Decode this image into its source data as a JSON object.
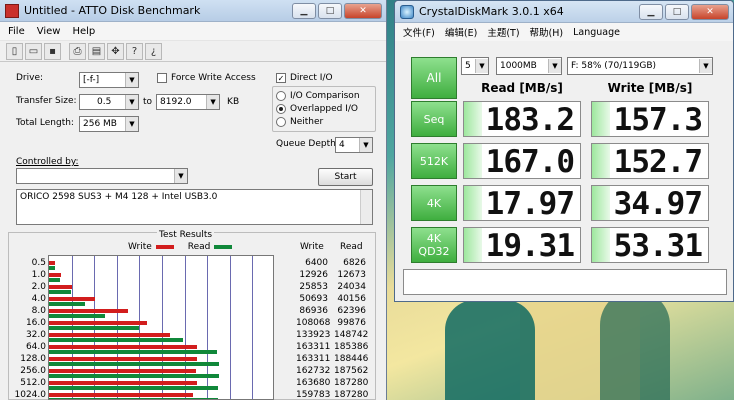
{
  "atto": {
    "title": "Untitled - ATTO Disk Benchmark",
    "menu": [
      "File",
      "View",
      "Help"
    ],
    "toolbar_icons": [
      "new-icon",
      "open-icon",
      "save-icon",
      "print-icon",
      "print-preview-icon",
      "move-icon",
      "help-icon",
      "context-help-icon"
    ],
    "drive_label": "Drive:",
    "drive_value": "[-f-]",
    "transfer_size_label": "Transfer Size:",
    "transfer_from": "0.5",
    "transfer_to_label": "to",
    "transfer_to": "8192.0",
    "transfer_unit": "KB",
    "total_length_label": "Total Length:",
    "total_length": "256 MB",
    "force_write_access": "Force Write Access",
    "direct_io": "Direct I/O",
    "io_comparison": "I/O Comparison",
    "overlapped_io": "Overlapped I/O",
    "neither": "Neither",
    "queue_depth_label": "Queue Depth:",
    "queue_depth": "4",
    "controlled_by_label": "Controlled by:",
    "controlled_by_value": "",
    "start_button": "Start",
    "description": "ORICO 2598 SUS3 + M4 128 + Intel USB3.0",
    "test_results_title": "Test Results",
    "legend_write": "Write",
    "legend_read": "Read",
    "col_write": "Write",
    "col_read": "Read",
    "colors": {
      "write": "#d21d1d",
      "read": "#10883a"
    }
  },
  "chart_data": {
    "type": "bar",
    "title": "Test Results",
    "categories": [
      "0.5",
      "1.0",
      "2.0",
      "4.0",
      "8.0",
      "16.0",
      "32.0",
      "64.0",
      "128.0",
      "256.0",
      "512.0",
      "1024.0"
    ],
    "series": [
      {
        "name": "Write",
        "values": [
          6400,
          12926,
          25853,
          50693,
          86936,
          108068,
          133923,
          163311,
          163311,
          162732,
          163680,
          159783
        ]
      },
      {
        "name": "Read",
        "values": [
          6826,
          12673,
          24034,
          40156,
          62396,
          99876,
          148742,
          185386,
          188446,
          187562,
          187280,
          187280
        ]
      }
    ],
    "xlim": [
      0,
      250000
    ]
  },
  "cdm": {
    "title": "CrystalDiskMark 3.0.1 x64",
    "menu": [
      "文件(F)",
      "编辑(E)",
      "主题(T)",
      "帮助(H)",
      "Language"
    ],
    "all_button": "All",
    "runs": "5",
    "size": "1000MB",
    "drive": "F: 58% (70/119GB)",
    "read_header": "Read [MB/s]",
    "write_header": "Write [MB/s]",
    "rows": [
      {
        "label": "Seq",
        "label2": "",
        "read": "183.2",
        "write": "157.3"
      },
      {
        "label": "512K",
        "label2": "",
        "read": "167.0",
        "write": "152.7"
      },
      {
        "label": "4K",
        "label2": "",
        "read": "17.97",
        "write": "34.97"
      },
      {
        "label": "4K",
        "label2": "QD32",
        "read": "19.31",
        "write": "53.31"
      }
    ]
  }
}
